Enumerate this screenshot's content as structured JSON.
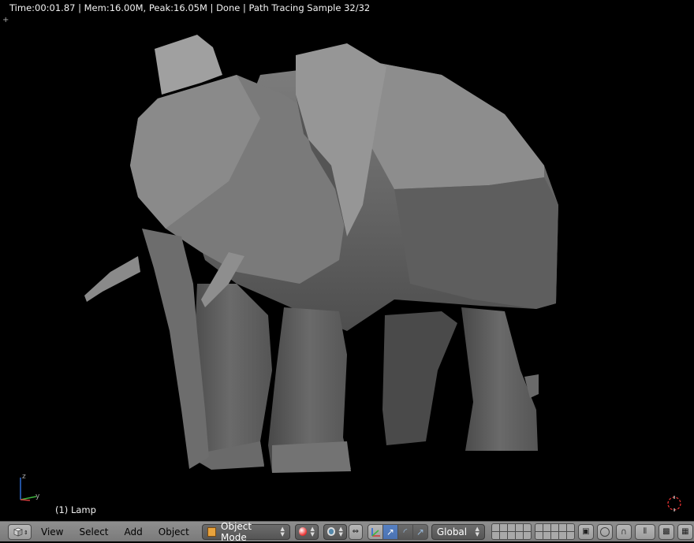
{
  "viewport": {
    "render_stats": "Time:00:01.87 | Mem:16.00M, Peak:16.05M | Done | Path Tracing Sample 32/32",
    "object_label": "(1) Lamp",
    "axis_labels": {
      "z": "z",
      "y": "y"
    }
  },
  "header": {
    "menus": {
      "view": "View",
      "select": "Select",
      "add": "Add",
      "object": "Object"
    },
    "mode_label": "Object Mode",
    "orientation_label": "Global"
  },
  "colors": {
    "background": "#000000",
    "header_bg": "#838383",
    "accent_active": "#5680c2",
    "elephant_light": "#9a9a9a",
    "elephant_dark": "#3c3c3c"
  }
}
